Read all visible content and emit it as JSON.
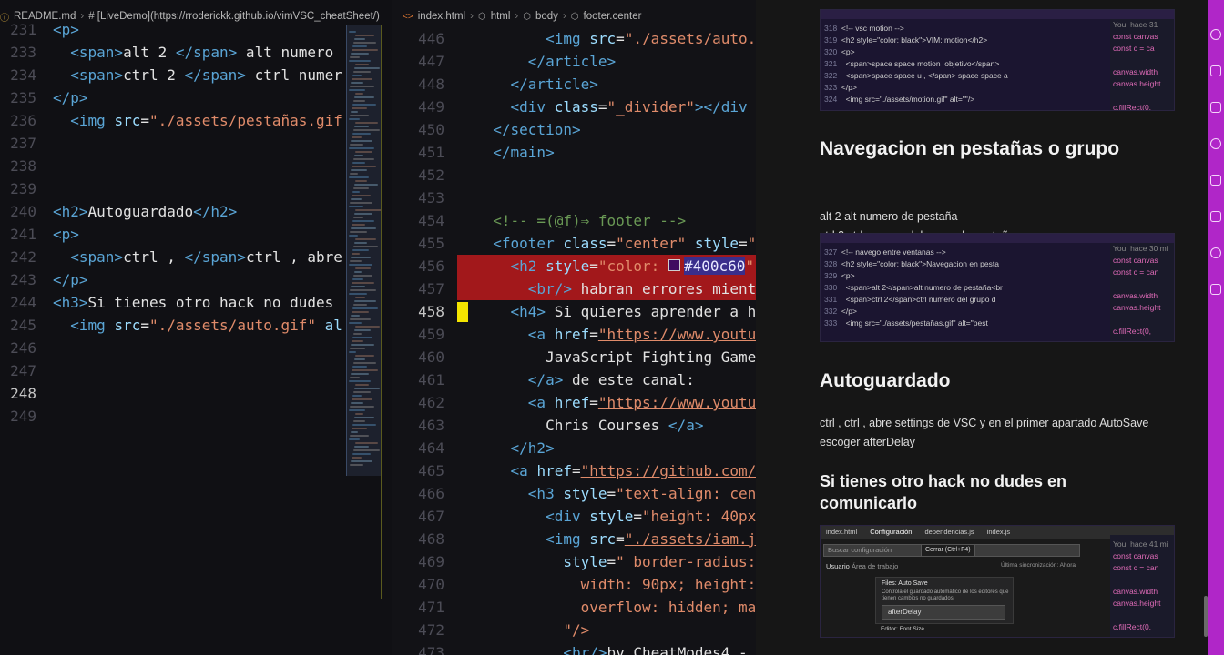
{
  "left_editor": {
    "breadcrumb": {
      "file": "README.md",
      "heading": "# [LiveDemo](https://rroderickk.github.io/vimVSC_cheatSheet/)"
    },
    "lines": [
      {
        "n": "231",
        "html": "<span class='t'>&lt;p&gt;</span>"
      },
      {
        "n": "233",
        "html": "  <span class='t'>&lt;span&gt;</span><span class='w'>alt 2 </span><span class='t'>&lt;/span&gt;</span><span class='w'> alt numero</span>"
      },
      {
        "n": "234",
        "html": "  <span class='t'>&lt;span&gt;</span><span class='w'>ctrl 2 </span><span class='t'>&lt;/span&gt;</span><span class='w'> ctrl numer</span>"
      },
      {
        "n": "235",
        "html": "<span class='t'>&lt;/p&gt;</span>"
      },
      {
        "n": "236",
        "html": "  <span class='t'>&lt;img </span><span class='a'>src</span><span class='w'>=</span><span class='s'>\"./assets/pestañas.gif</span>"
      },
      {
        "n": "237",
        "html": ""
      },
      {
        "n": "238",
        "html": ""
      },
      {
        "n": "239",
        "html": ""
      },
      {
        "n": "240",
        "html": "<span class='t'>&lt;h2&gt;</span><span class='w'>Autoguardado</span><span class='t'>&lt;/h2&gt;</span>"
      },
      {
        "n": "241",
        "html": "<span class='t'>&lt;p&gt;</span>"
      },
      {
        "n": "242",
        "html": "  <span class='t'>&lt;span&gt;</span><span class='w'>ctrl , </span><span class='t'>&lt;/span&gt;</span><span class='w'>ctrl , abre</span>"
      },
      {
        "n": "243",
        "html": "<span class='t'>&lt;/p&gt;</span>"
      },
      {
        "n": "244",
        "html": "<span class='t'>&lt;h3&gt;</span><span class='w'>Si tienes otro hack no dudes</span>"
      },
      {
        "n": "245",
        "html": "  <span class='t'>&lt;img </span><span class='a'>src</span><span class='w'>=</span><span class='s'>\"./assets/auto.gif\"</span><span class='a'> al</span>"
      },
      {
        "n": "246",
        "html": ""
      },
      {
        "n": "247",
        "html": ""
      },
      {
        "n": "248",
        "html": ""
      },
      {
        "n": "249",
        "html": ""
      }
    ]
  },
  "mid_editor": {
    "breadcrumb": [
      "index.html",
      "html",
      "body",
      "footer.center"
    ],
    "lines": [
      {
        "n": "446",
        "html": "        <span class='t'>&lt;img </span><span class='a'>src</span><span class='w'>=</span><span class='s u'>\"./assets/auto.g</span>"
      },
      {
        "n": "447",
        "html": "      <span class='t'>&lt;/article&gt;</span>"
      },
      {
        "n": "448",
        "html": "    <span class='t'>&lt;/article&gt;</span>"
      },
      {
        "n": "449",
        "html": "    <span class='t'>&lt;div </span><span class='a'>class</span><span class='w'>=</span><span class='s'>\"_divider\"</span><span class='t'>&gt;&lt;/div</span>"
      },
      {
        "n": "450",
        "html": "  <span class='t'>&lt;/section&gt;</span>"
      },
      {
        "n": "451",
        "html": "  <span class='t'>&lt;/main&gt;</span>"
      },
      {
        "n": "452",
        "html": ""
      },
      {
        "n": "453",
        "html": ""
      },
      {
        "n": "454",
        "html": "  <span class='c'>&lt;!-- =(@f)⇒ footer --&gt;</span>"
      },
      {
        "n": "455",
        "html": "  <span class='t'>&lt;footer </span><span class='a'>class</span><span class='w'>=</span><span class='s'>\"center\"</span><span class='a'> style</span><span class='w'>=</span><span class='s'>\"m</span>"
      },
      {
        "n": "456",
        "html": "    <span class='t'>&lt;h2 </span><span class='a'>style</span><span class='w'>=</span><span class='s'>\"color: <span class='swatch'></span><span class='hexsel'>#400c60</span>\"</span>"
      },
      {
        "n": "457",
        "html": "      <span class='t'>&lt;br/&gt;</span><span class='w'> habran errores mientr</span>"
      },
      {
        "n": "458",
        "html": "    <span class='t'>&lt;h4&gt;</span><span class='w'> Si quieres aprender a ha</span>"
      },
      {
        "n": "459",
        "html": "      <span class='t'>&lt;a </span><span class='a'>href</span><span class='w'>=</span><span class='s u'>\"https://www.youtub</span>"
      },
      {
        "n": "460",
        "html": "        <span class='w'>JavaScript Fighting Game</span>"
      },
      {
        "n": "461",
        "html": "      <span class='t'>&lt;/a&gt;</span><span class='w'> de este canal:</span>"
      },
      {
        "n": "462",
        "html": "      <span class='t'>&lt;a </span><span class='a'>href</span><span class='w'>=</span><span class='s u'>\"https://www.youtub</span>"
      },
      {
        "n": "463",
        "html": "        <span class='w'>Chris Courses </span><span class='t'>&lt;/a&gt;</span>"
      },
      {
        "n": "464",
        "html": "    <span class='t'>&lt;/h2&gt;</span>"
      },
      {
        "n": "465",
        "html": "    <span class='t'>&lt;a </span><span class='a'>href</span><span class='w'>=</span><span class='s u'>\"https://github.com/r</span>"
      },
      {
        "n": "466",
        "html": "      <span class='t'>&lt;h3 </span><span class='a'>style</span><span class='w'>=</span><span class='s'>\"text-align: cent</span>"
      },
      {
        "n": "467",
        "html": "        <span class='t'>&lt;div </span><span class='a'>style</span><span class='w'>=</span><span class='s'>\"height: 40px\"</span>"
      },
      {
        "n": "468",
        "html": "        <span class='t'>&lt;img </span><span class='a'>src</span><span class='w'>=</span><span class='s u'>\"./assets/iam.jp</span>"
      },
      {
        "n": "469",
        "html": "          <span class='a'>style</span><span class='w'>=</span><span class='s'>\" border-radius:</span>"
      },
      {
        "n": "470",
        "html": "            <span class='s'>width: 90px; height:</span>"
      },
      {
        "n": "471",
        "html": "            <span class='s'>overflow: hidden; mar</span>"
      },
      {
        "n": "472",
        "html": "          <span class='s'>\"/&gt;</span>"
      },
      {
        "n": "473",
        "html": "          <span class='t'>&lt;br/&gt;</span><span class='w'>by CheatModes4 - rro</span>"
      }
    ]
  },
  "preview": {
    "heading_navegacion": "Navegacion en pestañas o grupo",
    "nav_line1": "alt 2 alt numero de pestaña",
    "nav_line2": "ctrl 2 ctrl numero del grupo de pestaña",
    "heading_autoguardado": "Autoguardado",
    "auto_line1": "ctrl , ctrl , abre settings de VSC y en el primer apartado AutoSave",
    "auto_line2": "escoger afterDelay",
    "heading_hack": "Si tienes otro hack no dudes en comunicarlo",
    "shot1_lines": [
      {
        "n": "318",
        "t": "<!-- vsc motion -->"
      },
      {
        "n": "319",
        "t": "<h2 style=\"color: black\">VIM: motion</h2>"
      },
      {
        "n": "320",
        "t": "<p>"
      },
      {
        "n": "321",
        "t": "  <span>space space motion  objetivo</span>"
      },
      {
        "n": "322",
        "t": "  <span>space space u , </span> space space a"
      },
      {
        "n": "323",
        "t": "</p>"
      },
      {
        "n": "324",
        "t": "  <img src=\"./assets/motion.gif\" alt=\"\"/>"
      }
    ],
    "shot1_right": [
      "You, hace 31",
      "const canvas",
      "const c = ca",
      "",
      "canvas.width",
      "canvas.height",
      "",
      "c.fillRect(0,"
    ],
    "shot2_lines": [
      {
        "n": "327",
        "t": "<!-- navego entre ventanas -->"
      },
      {
        "n": "328",
        "t": "<h2 style=\"color: black\">Navegacion en pesta"
      },
      {
        "n": "329",
        "t": "<p>"
      },
      {
        "n": "330",
        "t": "  <span>alt 2</span>alt numero de pestaña<br"
      },
      {
        "n": "331",
        "t": "  <span>ctrl 2</span>ctrl numero del grupo d"
      },
      {
        "n": "332",
        "t": "</p>"
      },
      {
        "n": "333",
        "t": "  <img src=\"./assets/pestañas.gif\" alt=\"pest"
      }
    ],
    "shot2_right": [
      "You, hace 30 mi",
      "const canvas",
      "const c = can",
      "",
      "canvas.width",
      "canvas.height",
      "",
      "c.fillRect(0,"
    ],
    "shot3": {
      "tabs": [
        "index.html",
        "Configuración",
        "dependencias.js",
        "index.js"
      ],
      "search": "Buscar configuración",
      "tooltip": "Cerrar (Ctrl+F4)",
      "scope_user": "Usuario",
      "scope_workspace": "Área de trabajo",
      "sync": "Última sincronización: Ahora",
      "setting_title": "Files: Auto Save",
      "setting_desc": "Controla el guardado automático de los editores que tienen cambios no guardados.",
      "dropdown": "afterDelay",
      "next_setting": "Editor: Font Size",
      "right": [
        "You, hace 41 mi",
        "const canvas",
        "const c = can",
        "",
        "canvas.width",
        "canvas.height",
        "",
        "c.fillRect(0,"
      ]
    }
  },
  "colors": {
    "activity_bar": "#b026c8",
    "highlight_line": "#a2181b",
    "swatch": "#400c60",
    "cursor": "#f4e500"
  },
  "icons": {
    "activity": [
      "close-icon",
      "search-icon",
      "git-icon",
      "debug-icon",
      "extensions-icon",
      "remote-icon",
      "accounts-icon",
      "package-icon"
    ]
  }
}
